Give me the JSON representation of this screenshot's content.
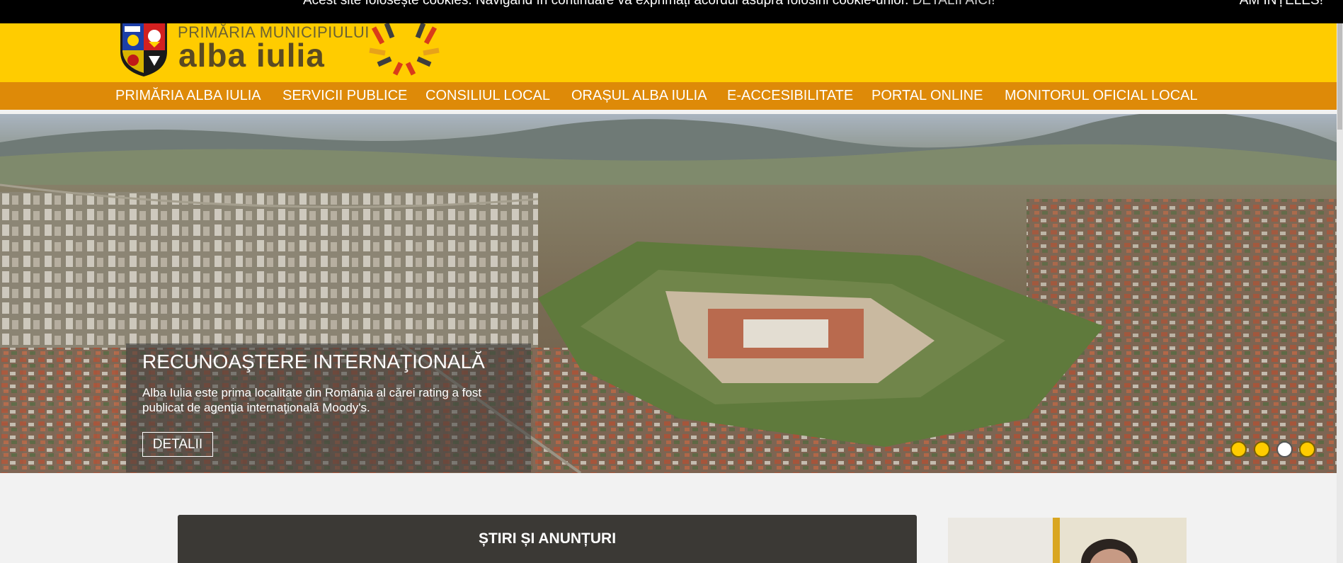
{
  "cookie": {
    "message": "Acest site folosește cookies. Navigând în continuare vă exprimați acordul asupra folosirii cookie-urilor.",
    "details_link": "DETALII AICI!",
    "accept_label": "AM ÎNȚELES!"
  },
  "header": {
    "logo_small": "PRIMĂRIA MUNICIPIULUI",
    "logo_big": "alba iulia"
  },
  "nav": {
    "items": [
      "PRIMĂRIA ALBA IULIA",
      "SERVICII PUBLICE",
      "CONSILIUL LOCAL",
      "ORAȘUL ALBA IULIA",
      "E-ACCESIBILITATE",
      "PORTAL ONLINE",
      "MONITORUL OFICIAL LOCAL"
    ]
  },
  "slider": {
    "title": "RECUNOAŞTERE INTERNAŢIONALĂ",
    "text": "Alba Iulia este prima localitate din România al cărei rating a fost publicat de agenţia internaţională Moody's.",
    "button_label": "DETALII",
    "slide_count": 4,
    "active_slide": 3
  },
  "news": {
    "title": "ȘTIRI ȘI ANUNȚURI"
  },
  "colors": {
    "header_yellow": "#ffcc00",
    "nav_orange": "#de8a08",
    "news_dark": "#3b3935"
  }
}
